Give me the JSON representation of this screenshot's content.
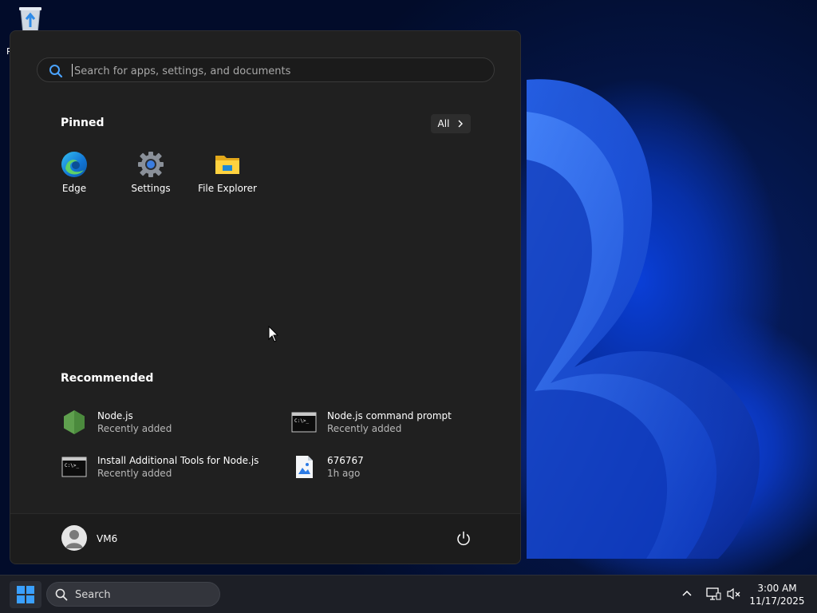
{
  "desktop": {
    "recycle_bin_label": "R"
  },
  "start_menu": {
    "search": {
      "placeholder": "Search for apps, settings, and documents",
      "value": ""
    },
    "pinned": {
      "title": "Pinned",
      "all_label": "All",
      "apps": [
        {
          "label": "Edge",
          "icon": "edge-icon"
        },
        {
          "label": "Settings",
          "icon": "gear-icon"
        },
        {
          "label": "File Explorer",
          "icon": "folder-icon"
        }
      ]
    },
    "recommended": {
      "title": "Recommended",
      "items": [
        {
          "title": "Node.js",
          "subtitle": "Recently added",
          "icon": "nodejs-icon"
        },
        {
          "title": "Node.js command prompt",
          "subtitle": "Recently added",
          "icon": "terminal-icon"
        },
        {
          "title": "Install Additional Tools for Node.js",
          "subtitle": "Recently added",
          "icon": "terminal-icon"
        },
        {
          "title": "676767",
          "subtitle": "1h ago",
          "icon": "image-file-icon"
        }
      ]
    },
    "footer": {
      "user_name": "VM6",
      "power_icon": "power-icon"
    }
  },
  "taskbar": {
    "search_label": "Search",
    "clock": {
      "time": "3:00 AM",
      "date": "11/17/2025"
    }
  },
  "colors": {
    "accent": "#0078d4",
    "menu_bg": "#202020",
    "taskbar_bg": "#1d1f26"
  }
}
